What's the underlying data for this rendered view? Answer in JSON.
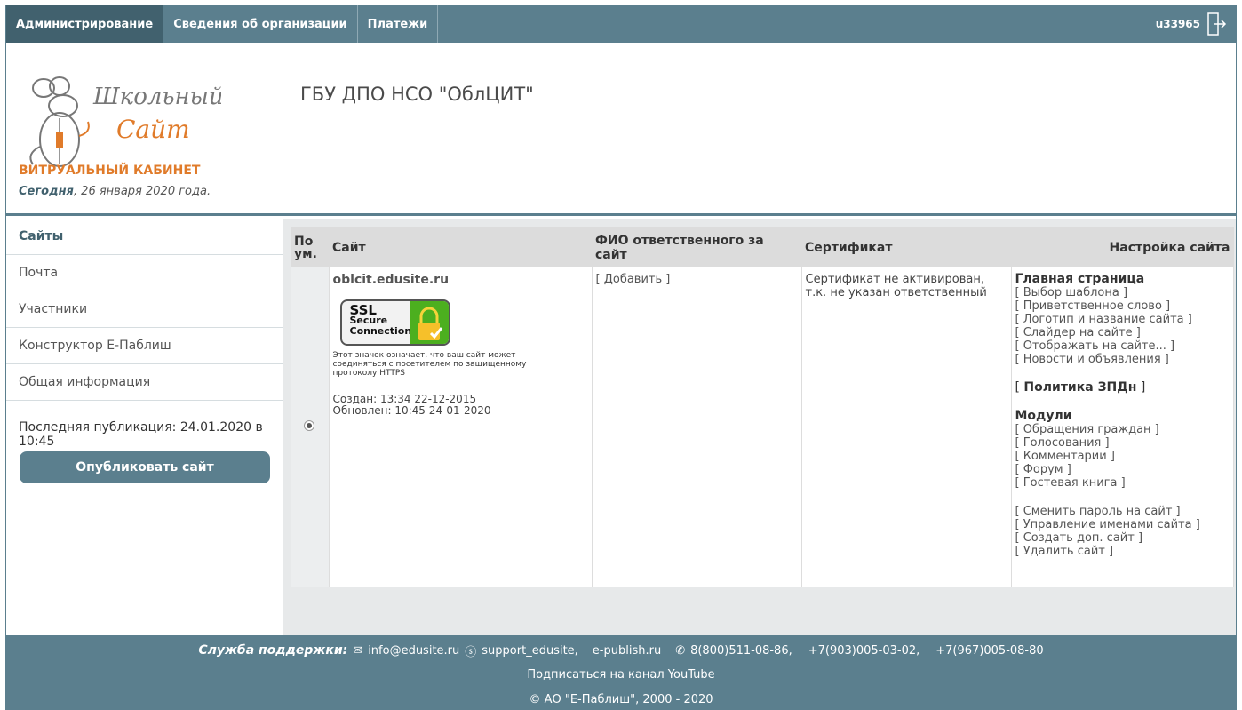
{
  "nav": {
    "tabs": [
      "Администрирование",
      "Сведения об организации",
      "Платежи"
    ],
    "user": "u33965"
  },
  "header": {
    "logo_line1": "Школьный",
    "logo_line2": "Сайт",
    "cabinet": "ВИТРУАЛЬНЫЙ КАБИНЕТ",
    "today_label": "Сегодня",
    "today_date": ", 26 января 2020 года.",
    "org_title": "ГБУ ДПО НСО \"ОблЦИТ\""
  },
  "sidebar": {
    "items": [
      "Сайты",
      "Почта",
      "Участники",
      "Конструктор Е-Паблиш",
      "Общая информация"
    ],
    "last_publication": "Последняя публикация: 24.01.2020 в 10:45",
    "publish_button": "Опубликовать сайт"
  },
  "table": {
    "headers": {
      "default": "По ум.",
      "site": "Сайт",
      "responsible": "ФИО ответственного за сайт",
      "certificate": "Сертификат",
      "settings": "Настройка сайта"
    },
    "row": {
      "domain": "oblcit.edusite.ru",
      "ssl_line1": "SSL",
      "ssl_line2": "Secure",
      "ssl_line3": "Connection",
      "ssl_note": "Этот значок означает, что ваш сайт может соединяться с посетителем по защищенному протоколу HTTPS",
      "created": "Создан: 13:34 22-12-2015",
      "updated": "Обновлен: 10:45 24-01-2020",
      "add_link": "[ Добавить ]",
      "certificate_text": "Сертификат не активирован, т.к. не указан ответственный"
    },
    "settings": {
      "main_heading": "Главная страница",
      "main_links": [
        "[ Выбор шаблона ]",
        "[ Приветственное слово ]",
        "[ Логотип и название сайта ]",
        "[ Слайдер на сайте ]",
        "[ Отображать на сайте... ]",
        "[ Новости и объявления ]"
      ],
      "policy_open": "[ ",
      "policy": "Политика ЗПДн",
      "policy_close": " ]",
      "modules_heading": "Модули",
      "module_links": [
        "[ Обращения граждан ]",
        "[ Голосования ]",
        "[ Комментарии ]",
        "[ Форум ]",
        "[ Гостевая книга ]"
      ],
      "account_links": [
        "[ Сменить пароль на сайт ]",
        "[ Управление именами сайта ]",
        "[ Создать доп. сайт ]",
        "[ Удалить сайт ]"
      ]
    }
  },
  "footer": {
    "support_label": "Служба поддержки:",
    "email": "info@edusite.ru",
    "skype": "support_edusite,",
    "site": "e-publish.ru",
    "phone1": "8(800)511-08-86,",
    "phone2": "+7(903)005-03-02,",
    "phone3": "+7(967)005-08-80",
    "youtube": "Подписаться на канал YouTube",
    "copyright": "© АО \"Е-Паблиш\", 2000 - 2020"
  },
  "colors": {
    "primary": "#5b7f8e",
    "active_tab": "#41616e",
    "accent_orange": "#e07b2a"
  }
}
